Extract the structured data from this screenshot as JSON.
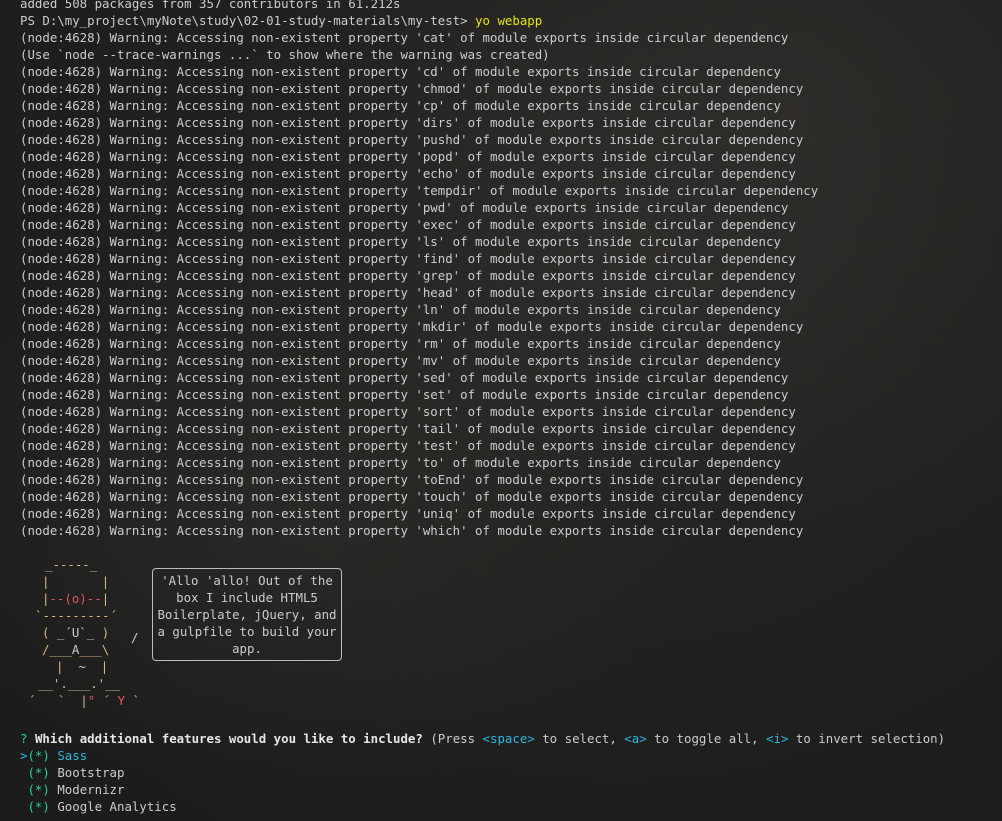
{
  "terminal": {
    "added_line": "added 508 packages from 357 contributors in 61.212s",
    "prompt": {
      "path": "PS D:\\my_project\\myNote\\study\\02-01-study-materials\\my-test> ",
      "command": "yo webapp"
    },
    "warnings": [
      "(node:4628) Warning: Accessing non-existent property 'cat' of module exports inside circular dependency",
      "(Use `node --trace-warnings ...` to show where the warning was created)",
      "(node:4628) Warning: Accessing non-existent property 'cd' of module exports inside circular dependency",
      "(node:4628) Warning: Accessing non-existent property 'chmod' of module exports inside circular dependency",
      "(node:4628) Warning: Accessing non-existent property 'cp' of module exports inside circular dependency",
      "(node:4628) Warning: Accessing non-existent property 'dirs' of module exports inside circular dependency",
      "(node:4628) Warning: Accessing non-existent property 'pushd' of module exports inside circular dependency",
      "(node:4628) Warning: Accessing non-existent property 'popd' of module exports inside circular dependency",
      "(node:4628) Warning: Accessing non-existent property 'echo' of module exports inside circular dependency",
      "(node:4628) Warning: Accessing non-existent property 'tempdir' of module exports inside circular dependency",
      "(node:4628) Warning: Accessing non-existent property 'pwd' of module exports inside circular dependency",
      "(node:4628) Warning: Accessing non-existent property 'exec' of module exports inside circular dependency",
      "(node:4628) Warning: Accessing non-existent property 'ls' of module exports inside circular dependency",
      "(node:4628) Warning: Accessing non-existent property 'find' of module exports inside circular dependency",
      "(node:4628) Warning: Accessing non-existent property 'grep' of module exports inside circular dependency",
      "(node:4628) Warning: Accessing non-existent property 'head' of module exports inside circular dependency",
      "(node:4628) Warning: Accessing non-existent property 'ln' of module exports inside circular dependency",
      "(node:4628) Warning: Accessing non-existent property 'mkdir' of module exports inside circular dependency",
      "(node:4628) Warning: Accessing non-existent property 'rm' of module exports inside circular dependency",
      "(node:4628) Warning: Accessing non-existent property 'mv' of module exports inside circular dependency",
      "(node:4628) Warning: Accessing non-existent property 'sed' of module exports inside circular dependency",
      "(node:4628) Warning: Accessing non-existent property 'set' of module exports inside circular dependency",
      "(node:4628) Warning: Accessing non-existent property 'sort' of module exports inside circular dependency",
      "(node:4628) Warning: Accessing non-existent property 'tail' of module exports inside circular dependency",
      "(node:4628) Warning: Accessing non-existent property 'test' of module exports inside circular dependency",
      "(node:4628) Warning: Accessing non-existent property 'to' of module exports inside circular dependency",
      "(node:4628) Warning: Accessing non-existent property 'toEnd' of module exports inside circular dependency",
      "(node:4628) Warning: Accessing non-existent property 'touch' of module exports inside circular dependency",
      "(node:4628) Warning: Accessing non-existent property 'uniq' of module exports inside circular dependency",
      "(node:4628) Warning: Accessing non-existent property 'which' of module exports inside circular dependency"
    ],
    "yeoman": {
      "speech_lines": [
        "'Allo 'allo! Out of the",
        "box I include HTML5",
        "Boilerplate, jQuery, and",
        "a gulpfile to build your",
        "app."
      ],
      "speech_tail": "/"
    },
    "question": {
      "mark": "?",
      "text": "Which additional features would you like to include?",
      "hint_open": " (Press ",
      "key_space": "<space>",
      "hint_select": " to select, ",
      "key_a": "<a>",
      "hint_toggle": " to toggle all, ",
      "key_i": "<i>",
      "hint_invert": " to invert selection)"
    },
    "options": [
      {
        "pointer": ">",
        "marker": "(*) ",
        "label": "Sass"
      },
      {
        "pointer": " ",
        "marker": "(*) ",
        "label": "Bootstrap"
      },
      {
        "pointer": " ",
        "marker": "(*) ",
        "label": "Modernizr"
      },
      {
        "pointer": " ",
        "marker": "(*) ",
        "label": "Google Analytics"
      }
    ],
    "colors": {
      "command": "#e5e510",
      "question_mark": "#23d18b",
      "key_hint": "#29b8db",
      "active_option": "#29b8db",
      "checkbox": "#23d18b"
    }
  }
}
